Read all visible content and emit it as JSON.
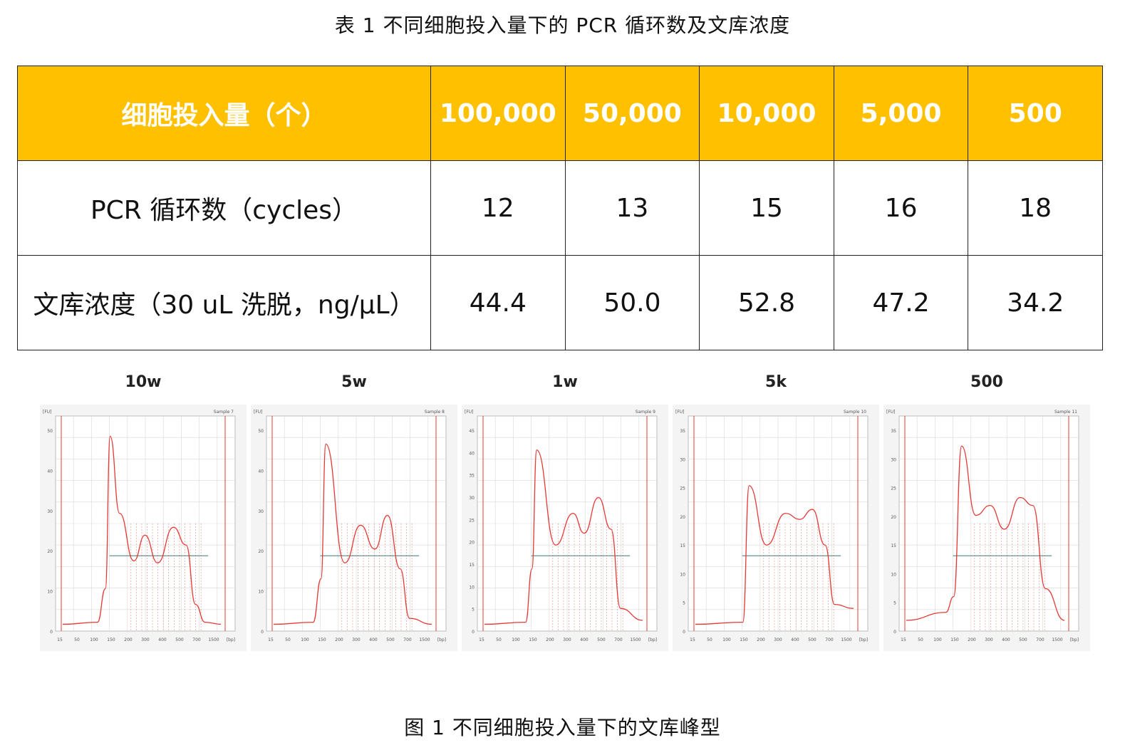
{
  "table_caption": "表 1  不同细胞投入量下的 PCR 循环数及文库浓度",
  "table": {
    "header": [
      "细胞投入量（个）",
      "100,000",
      "50,000",
      "10,000",
      "5,000",
      "500"
    ],
    "rows": [
      [
        "PCR 循环数（cycles）",
        "12",
        "13",
        "15",
        "16",
        "18"
      ],
      [
        "文库浓度（30 uL 洗脱，ng/μL）",
        "44.4",
        "50.0",
        "52.8",
        "47.2",
        "34.2"
      ]
    ],
    "header_color": "#ffc000"
  },
  "panels": [
    {
      "title": "10w",
      "sample": "Sample 7",
      "yunit": "[FU]",
      "yticks": [
        "0",
        "10",
        "20",
        "30",
        "40",
        "50"
      ]
    },
    {
      "title": "5w",
      "sample": "Sample 8",
      "yunit": "[FU]",
      "yticks": [
        "0",
        "10",
        "20",
        "30",
        "40",
        "50"
      ]
    },
    {
      "title": "1w",
      "sample": "Sample 9",
      "yunit": "[FU]",
      "yticks": [
        "0",
        "5",
        "10",
        "15",
        "20",
        "25",
        "30",
        "35",
        "40",
        "45"
      ]
    },
    {
      "title": "5k",
      "sample": "Sample 10",
      "yunit": "[FU]",
      "yticks": [
        "0",
        "5",
        "10",
        "15",
        "20",
        "25",
        "30",
        "35"
      ]
    },
    {
      "title": "500",
      "sample": "Sample 11",
      "yunit": "[FU]",
      "yticks": [
        "0",
        "5",
        "10",
        "15",
        "20",
        "25",
        "30",
        "35"
      ]
    }
  ],
  "xticks": [
    "15",
    "50",
    "100",
    "150",
    "200",
    "300",
    "400",
    "500",
    "700",
    "1500",
    "[bp]"
  ],
  "figure_caption": "图 1  不同细胞投入量下的文库峰型",
  "colors": {
    "trace": "#e53935",
    "grid": "#d9d9d9",
    "baseline": "#3b7a77"
  }
}
